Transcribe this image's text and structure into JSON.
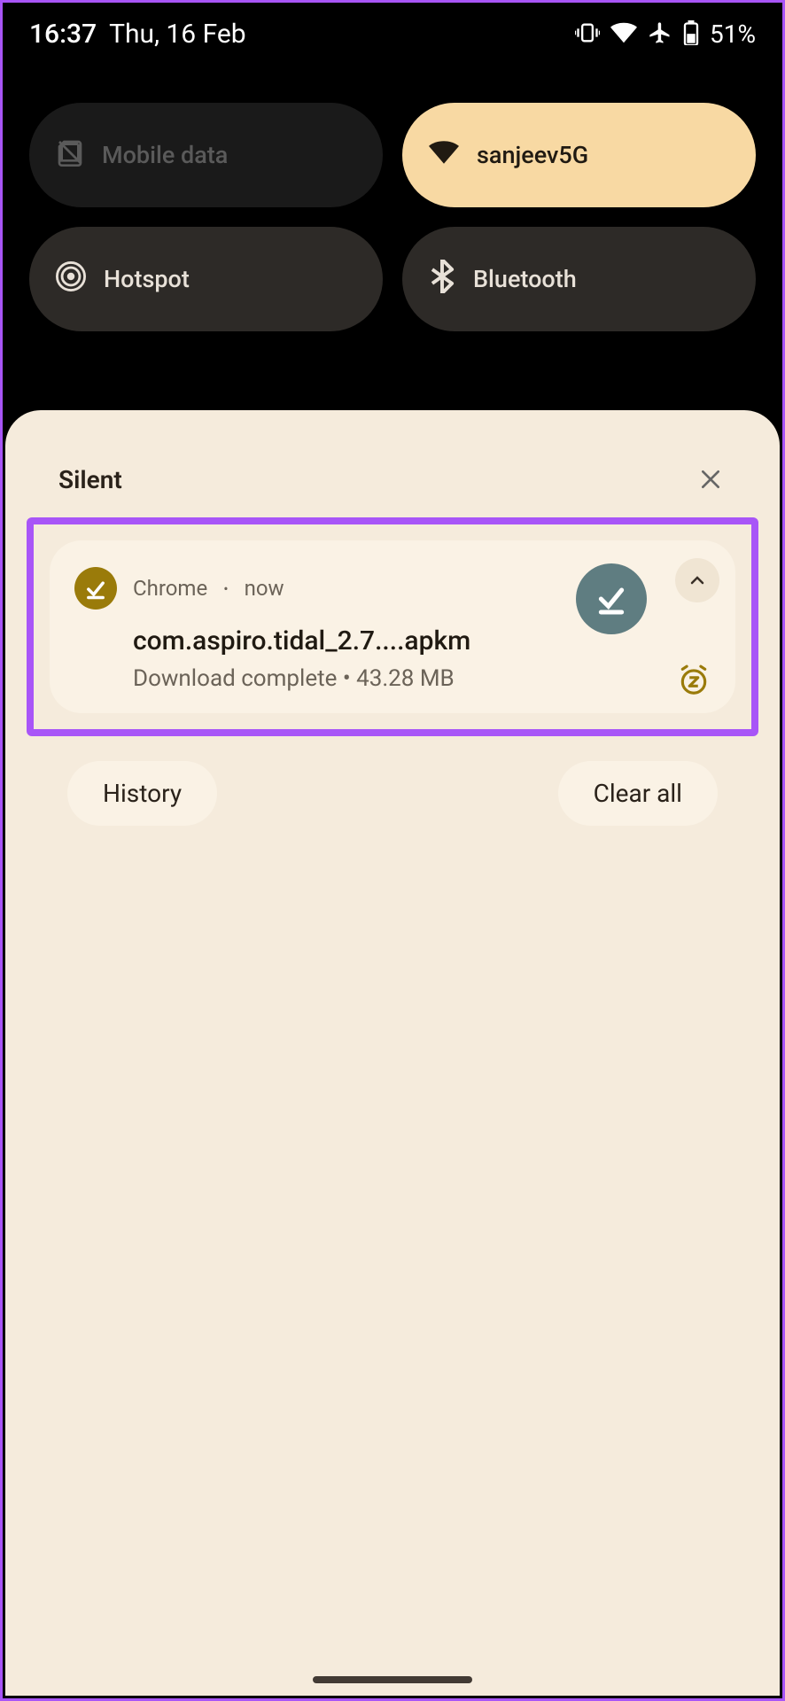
{
  "status": {
    "time": "16:37",
    "date": "Thu, 16 Feb",
    "battery": "51%"
  },
  "quickSettings": {
    "tiles": [
      {
        "label": "Mobile data",
        "state": "disabled"
      },
      {
        "label": "sanjeev5G",
        "state": "on"
      },
      {
        "label": "Hotspot",
        "state": "off"
      },
      {
        "label": "Bluetooth",
        "state": "off"
      }
    ]
  },
  "notificationShade": {
    "sectionTitle": "Silent",
    "notification": {
      "appName": "Chrome",
      "timeLabel": "now",
      "title": "com.aspiro.tidal_2.7....apkm",
      "subtitle": "Download complete • 43.28 MB"
    },
    "actions": {
      "history": "History",
      "clearAll": "Clear all"
    }
  }
}
